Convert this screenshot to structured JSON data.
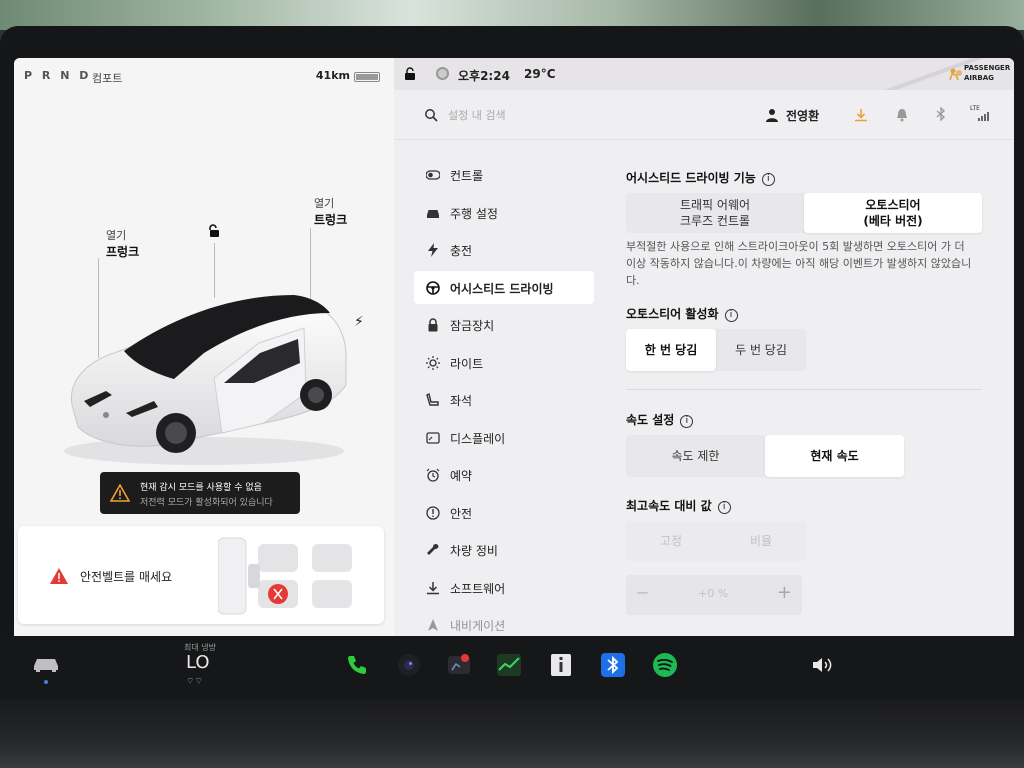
{
  "left_status": {
    "gear": "P R N D",
    "mode": "컴포트",
    "range": "41km",
    "battery_level": 0.9
  },
  "car_view": {
    "frunk_action": "열기",
    "frunk_label": "프렁크",
    "trunk_action": "열기",
    "trunk_label": "트렁크"
  },
  "warning": {
    "line1": "현재 감시 모드를 사용할 수 없음",
    "line2": "저전력 모드가 활성화되어 있습니다"
  },
  "seatbelt_alert": {
    "text": "안전벨트를 매세요"
  },
  "top_status": {
    "time": "오후2:24",
    "temperature": "29°C",
    "airbag_line1": "PASSENGER",
    "airbag_line2": "AIRBAG"
  },
  "search": {
    "placeholder": "설정 내 검색"
  },
  "profile": {
    "name": "전영환",
    "network": "LTE"
  },
  "menu": {
    "items": [
      {
        "label": "컨트롤",
        "icon": "toggle-icon"
      },
      {
        "label": "주행 설정",
        "icon": "car-icon"
      },
      {
        "label": "충전",
        "icon": "bolt-icon"
      },
      {
        "label": "어시스티드 드라이빙",
        "icon": "steering-wheel-icon",
        "active": true
      },
      {
        "label": "잠금장치",
        "icon": "lock-icon"
      },
      {
        "label": "라이트",
        "icon": "light-icon"
      },
      {
        "label": "좌석",
        "icon": "seat-icon"
      },
      {
        "label": "디스플레이",
        "icon": "display-icon"
      },
      {
        "label": "예약",
        "icon": "alarm-icon"
      },
      {
        "label": "안전",
        "icon": "alert-icon"
      },
      {
        "label": "차량 정비",
        "icon": "wrench-icon"
      },
      {
        "label": "소프트웨어",
        "icon": "download-icon"
      },
      {
        "label": "내비게이션",
        "icon": "navigation-icon"
      }
    ]
  },
  "assisted_driving": {
    "feature_title": "어시스티드 드라이빙 기능",
    "feature_options": [
      {
        "line1": "트래픽 어웨어",
        "line2": "크루즈 컨트롤",
        "selected": false
      },
      {
        "line1": "오토스티어",
        "line2": "(베타 버전)",
        "selected": true
      }
    ],
    "strike_line1": "부적절한 사용으로 인해 스트라이크아웃이 5회 발생하면 오토스티어 가 더",
    "strike_line2": "이상 작동하지 않습니다.이 차량에는 아직 해당 이벤트가 발생하지 않았습니",
    "strike_line3": "다.",
    "autosteer_title": "오토스티어 활성화",
    "autosteer_options": [
      {
        "label": "한 번 당김",
        "selected": true
      },
      {
        "label": "두 번 당김",
        "selected": false
      }
    ],
    "speed_title": "속도 설정",
    "speed_options": [
      {
        "label": "속도 제한",
        "selected": false
      },
      {
        "label": "현재 속도",
        "selected": true
      }
    ],
    "offset_title": "최고속도 대비 값",
    "offset_options": [
      {
        "label": "고정",
        "selected": false
      },
      {
        "label": "비율",
        "selected": false
      }
    ],
    "offset_minus": "−",
    "offset_value": "+0 %",
    "offset_plus": "+"
  },
  "dock": {
    "climate_label": "최대 냉방",
    "climate_value": "LO",
    "climate_fan": "⌔⌔"
  },
  "colors": {
    "alert_red": "#e53935",
    "download_orange": "#e8a23a",
    "phone_green": "#2ecc40",
    "bluetooth_blue": "#1e6fe8",
    "spotify_green": "#1db954"
  }
}
